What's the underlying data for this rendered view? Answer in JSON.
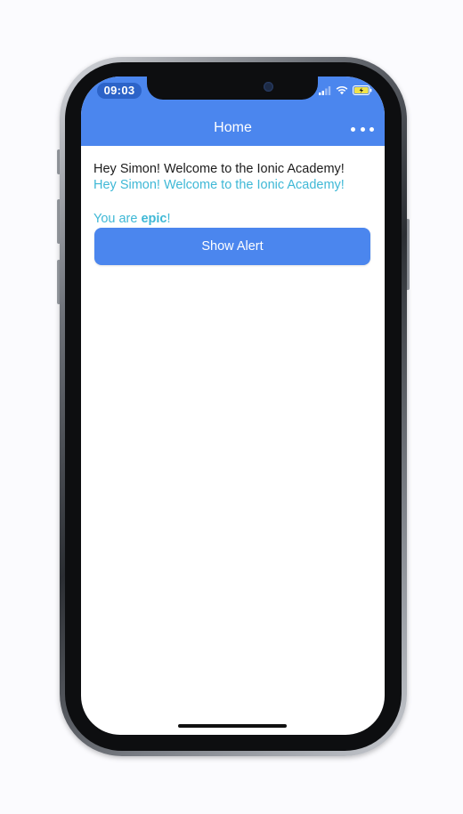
{
  "status_bar": {
    "time": "09:03",
    "icons": [
      "signal-icon",
      "wifi-icon",
      "battery-icon"
    ]
  },
  "toolbar": {
    "title": "Home",
    "more_icon": "ellipsis-icon"
  },
  "content": {
    "greeting_plain": "Hey Simon! Welcome to the Ionic Academy!",
    "greeting_colored": "Hey Simon! Welcome to the Ionic Academy!",
    "status_prefix": "You are ",
    "status_emphasis": "epic",
    "status_suffix": "!"
  },
  "actions": {
    "show_alert_label": "Show Alert"
  },
  "colors": {
    "primary": "#4b86ee",
    "secondary": "#3fb8d6",
    "text": "#1c1c1c"
  }
}
